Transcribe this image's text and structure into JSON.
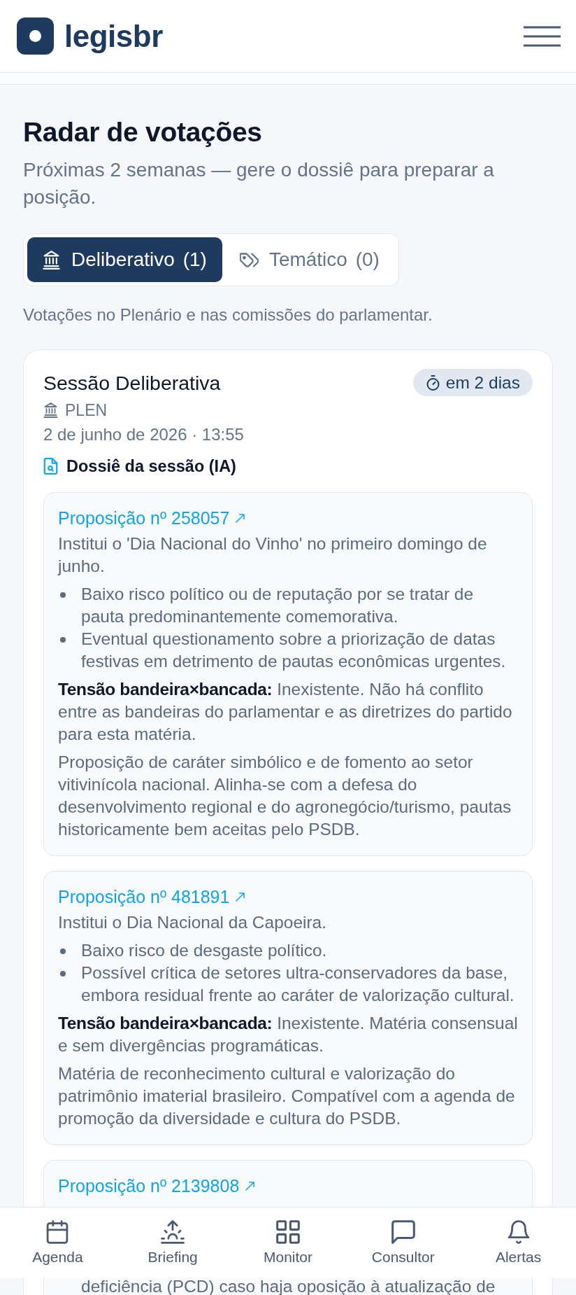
{
  "header": {
    "logo_text": "legisbr"
  },
  "page": {
    "title": "Radar de votações",
    "subtitle": "Próximas 2 semanas — gere o dossiê para preparar a posição."
  },
  "tabs": [
    {
      "kind": "plenary",
      "label": "Deliberativo",
      "count": "(1)",
      "selected": true
    },
    {
      "kind": "thematic",
      "label": "Temático",
      "count": "(0)",
      "selected": false
    }
  ],
  "tab_description": "Votações no Plenário e nas comissões do parlamentar.",
  "sessions": [
    {
      "title": "Sessão Deliberativa",
      "countdown": "em 2 dias",
      "chamber": "PLEN",
      "datetime": "2 de junho de 2026 · 13:55",
      "dossier_link": "Dossiê da sessão (IA)",
      "propositions": [
        {
          "title": "Proposição nº 258057",
          "summary": "Institui o 'Dia Nacional do Vinho' no primeiro domingo de junho.",
          "risks": [
            "Baixo risco político ou de reputação por se tratar de pauta predominantemente comemorativa.",
            "Eventual questionamento sobre a priorização de datas festivas em detrimento de pautas econômicas urgentes."
          ],
          "tension": "**Tensão bandeira×bancada:** Inexistente. Não há conflito entre as bandeiras do parlamentar e as diretrizes do partido para esta matéria.",
          "analysis": "Proposição de caráter simbólico e de fomento ao setor vitivinícola nacional. Alinha-se com a defesa do desenvolvimento regional e do agronegócio/turismo, pautas historicamente bem aceitas pelo PSDB."
        },
        {
          "title": "Proposição nº 481891",
          "summary": "Institui o Dia Nacional da Capoeira.",
          "risks": [
            "Baixo risco de desgaste político.",
            "Possível crítica de setores ultra-conservadores da base, embora residual frente ao caráter de valorização cultural."
          ],
          "tension": "**Tensão bandeira×bancada:** Inexistente. Matéria consensual e sem divergências programáticas.",
          "analysis": "Matéria de reconhecimento cultural e valorização do patrimônio imaterial brasileiro. Compatível com a agenda de promoção da diversidade e cultura do PSDB."
        },
        {
          "title": "Proposição nº 2139808",
          "risk_fragment": "deficiência (PCD) caso haja oposição à atualização de"
        }
      ]
    }
  ],
  "bottom_nav": [
    {
      "kind": "agenda",
      "label": "Agenda"
    },
    {
      "kind": "briefing",
      "label": "Briefing"
    },
    {
      "kind": "monitor",
      "label": "Monitor"
    },
    {
      "kind": "consultant",
      "label": "Consultor"
    },
    {
      "kind": "alerts",
      "label": "Alertas"
    }
  ]
}
